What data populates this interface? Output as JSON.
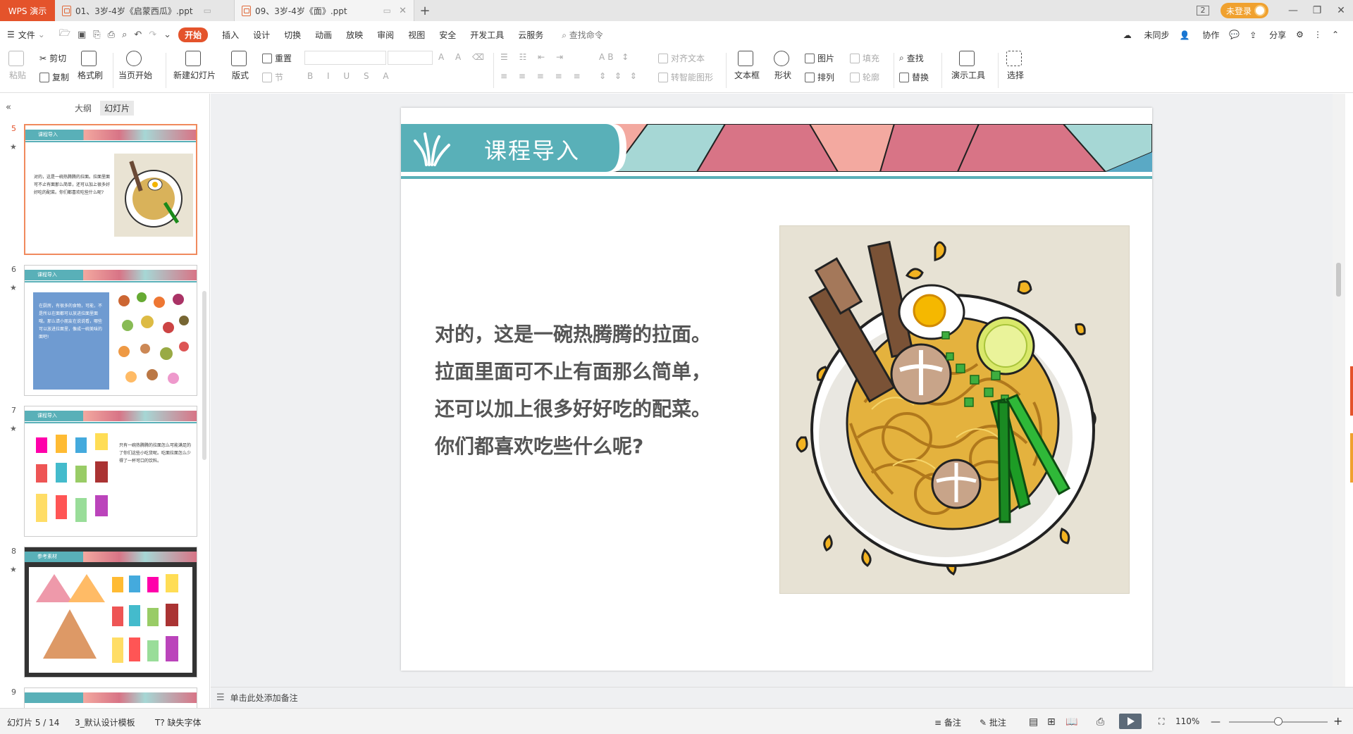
{
  "app": {
    "brand": "WPS 演示"
  },
  "tabs": [
    {
      "label": "01、3岁-4岁《启蒙西瓜》.ppt"
    },
    {
      "label": "09、3岁-4岁《面》.ppt"
    }
  ],
  "window": {
    "badge": "2",
    "login_label": "未登录"
  },
  "menu": {
    "file_label": "文件",
    "items": [
      "开始",
      "插入",
      "设计",
      "切换",
      "动画",
      "放映",
      "审阅",
      "视图",
      "安全",
      "开发工具",
      "云服务"
    ],
    "search_placeholder": "查找命令",
    "sync_label": "未同步",
    "collab_label": "协作",
    "share_label": "分享"
  },
  "ribbon": {
    "paste": "粘贴",
    "cut": "剪切",
    "copy": "复制",
    "format_painter": "格式刷",
    "from_current": "当页开始",
    "new_slide": "新建幻灯片",
    "layout": "版式",
    "reset": "重置",
    "section": "节",
    "align_text": "对齐文本",
    "smart_shape": "转智能图形",
    "textbox": "文本框",
    "shape": "形状",
    "picture": "图片",
    "arrange": "排列",
    "fill": "填充",
    "outline": "轮廓",
    "find": "查找",
    "replace": "替换",
    "present_tools": "演示工具",
    "select": "选择"
  },
  "left_pane": {
    "tab_outline": "大纲",
    "tab_slides": "幻灯片",
    "thumbs": [
      {
        "num": "5",
        "label": "课程导入",
        "text": "对的，这是一碗热腾腾的拉面。拉面里面可不止有面那么简单，还可以加上很多好好吃的配菜。你们都喜欢吃些什么呢?"
      },
      {
        "num": "6",
        "label": "课程导入",
        "text": "在厨房，有很多的食物，可能，不是所以在面都可以放进拉面里面哦。那么请小朋友在说说看，哪些可以放进拉面里，像成一碗美味的面吧!"
      },
      {
        "num": "7",
        "label": "课程导入",
        "text": "只有一碗热腾腾的拉面怎么可能满足的了你们这些小吃货呢。吃面拉面怎么少得了一杯可口的饮料。"
      },
      {
        "num": "8",
        "label": "参考素材",
        "text": ""
      },
      {
        "num": "9",
        "label": "",
        "text": ""
      }
    ]
  },
  "slide": {
    "title": "课程导入",
    "body_lines": [
      "对的，这是一碗热腾腾的拉面。",
      "拉面里面可不止有面那么简单，",
      "还可以加上很多好好吃的配菜。",
      "你们都喜欢吃些什么呢?"
    ]
  },
  "notes": {
    "placeholder": "单击此处添加备注"
  },
  "status": {
    "slide_counter": "幻灯片 5 / 14",
    "template": "3_默认设计模板",
    "missing_font": "缺失字体",
    "notes": "备注",
    "comments": "批注",
    "zoom": "110%"
  },
  "colors": {
    "accent": "#e4532b",
    "teal": "#59b0b8",
    "pink": "#d87486",
    "salmon": "#f3a9a0",
    "mint": "#a6d7d5"
  }
}
